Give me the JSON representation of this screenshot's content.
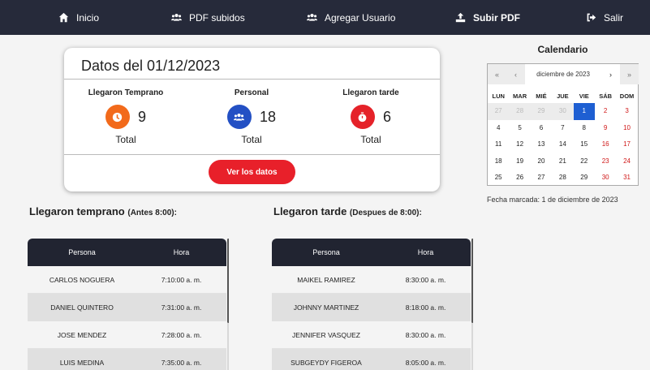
{
  "nav": {
    "inicio": "Inicio",
    "pdf_subidos": "PDF subidos",
    "agregar_usuario": "Agregar Usuario",
    "subir_pdf": "Subir PDF",
    "salir": "Salir"
  },
  "summary": {
    "title": "Datos del 01/12/2023",
    "temprano": {
      "label": "Llegaron Temprano",
      "count": "9",
      "total_label": "Total",
      "color": "#f26a1b"
    },
    "personal": {
      "label": "Personal",
      "count": "18",
      "total_label": "Total",
      "color": "#2350c4"
    },
    "tarde": {
      "label": "Llegaron tarde",
      "count": "6",
      "total_label": "Total",
      "color": "#e52229"
    },
    "button_label": "Ver los datos",
    "button_color": "#e8202a"
  },
  "calendar": {
    "title": "Calendario",
    "month_label": "diciembre de 2023",
    "prev_year": "«",
    "prev_month": "‹",
    "next_month": "›",
    "next_year": "»",
    "weekdays": [
      "LUN",
      "MAR",
      "MIÉ",
      "JUE",
      "VIE",
      "SÁB",
      "DOM"
    ],
    "weeks": [
      [
        "27",
        "28",
        "29",
        "30",
        "1",
        "2",
        "3"
      ],
      [
        "4",
        "5",
        "6",
        "7",
        "8",
        "9",
        "10"
      ],
      [
        "11",
        "12",
        "13",
        "14",
        "15",
        "16",
        "17"
      ],
      [
        "18",
        "19",
        "20",
        "21",
        "22",
        "23",
        "24"
      ],
      [
        "25",
        "26",
        "27",
        "28",
        "29",
        "30",
        "31"
      ]
    ],
    "selected_day": "1",
    "selected_color": "#1e5fd2",
    "weekend_color": "#d01818",
    "note": "Fecha marcada: 1 de diciembre de 2023"
  },
  "early": {
    "title": "Llegaron temprano",
    "subtitle": "(Antes 8:00):",
    "headers": [
      "Persona",
      "Hora"
    ],
    "rows": [
      [
        "CARLOS NOGUERA",
        "7:10:00 a. m."
      ],
      [
        "DANIEL QUINTERO",
        "7:31:00 a. m."
      ],
      [
        "JOSE MENDEZ",
        "7:28:00 a. m."
      ],
      [
        "LUIS MEDINA",
        "7:35:00 a. m."
      ]
    ]
  },
  "late": {
    "title": "Llegaron tarde",
    "subtitle": "(Despues de 8:00):",
    "headers": [
      "Persona",
      "Hora"
    ],
    "rows": [
      [
        "MAIKEL RAMIREZ",
        "8:30:00 a. m."
      ],
      [
        "JOHNNY MARTINEZ",
        "8:18:00 a. m."
      ],
      [
        "JENNIFER VASQUEZ",
        "8:30:00 a. m."
      ],
      [
        "SUBGEYDY FIGEROA",
        "8:05:00 a. m."
      ]
    ]
  }
}
